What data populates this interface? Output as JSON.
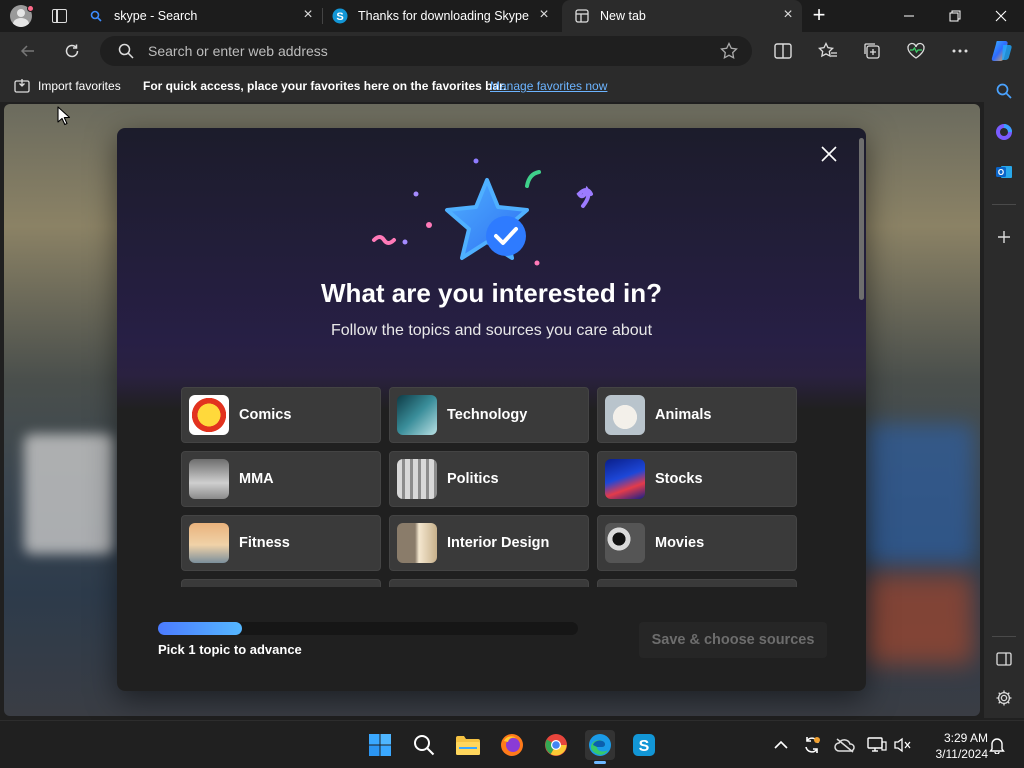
{
  "tabs": [
    {
      "title": "skype - Search",
      "active": false
    },
    {
      "title": "Thanks for downloading Skype",
      "active": false
    },
    {
      "title": "New tab",
      "active": true
    }
  ],
  "address_bar": {
    "placeholder": "Search or enter web address"
  },
  "favorites_bar": {
    "import_label": "Import favorites",
    "hint": "For quick access, place your favorites here on the favorites bar.",
    "manage_link": "Manage favorites now"
  },
  "modal": {
    "title": "What are you interested in?",
    "subtitle": "Follow the topics and sources you care about",
    "topics": [
      {
        "label": "Comics"
      },
      {
        "label": "Technology"
      },
      {
        "label": "Animals"
      },
      {
        "label": "MMA"
      },
      {
        "label": "Politics"
      },
      {
        "label": "Stocks"
      },
      {
        "label": "Fitness"
      },
      {
        "label": "Interior Design"
      },
      {
        "label": "Movies"
      }
    ],
    "progress_fraction": 0.2,
    "progress_label": "Pick 1 topic to advance",
    "save_button": "Save & choose sources"
  },
  "taskbar": {
    "clock_time": "3:29 AM",
    "clock_date": "3/11/2024"
  },
  "colors": {
    "accent": "#4b7bff",
    "link": "#6cb4ff",
    "modal_bg": "#202020"
  }
}
